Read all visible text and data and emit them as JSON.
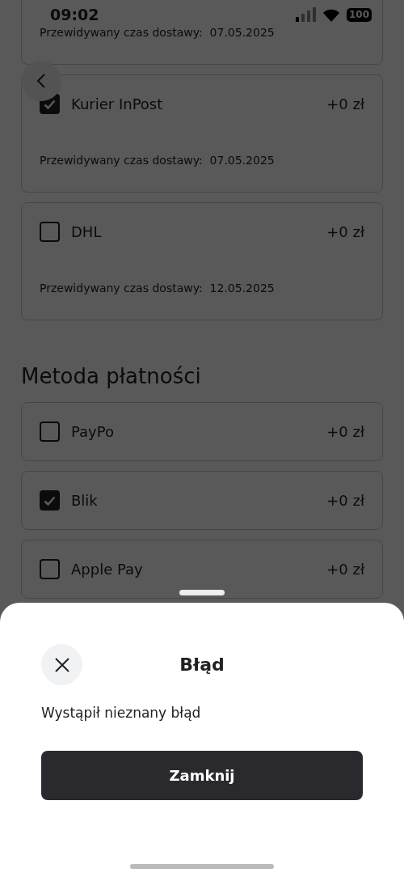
{
  "status_bar": {
    "time": "09:02",
    "battery": "100"
  },
  "partial_delivery_option": {
    "eta_label": "Przewidywany czas dostawy:",
    "eta": "07.05.2025"
  },
  "delivery_options": [
    {
      "name": "Kurier InPost",
      "price": "+0 zł",
      "checked": true,
      "eta_label": "Przewidywany czas dostawy:",
      "eta": "07.05.2025"
    },
    {
      "name": "DHL",
      "price": "+0 zł",
      "checked": false,
      "eta_label": "Przewidywany czas dostawy:",
      "eta": "12.05.2025"
    }
  ],
  "payment_section": {
    "title": "Metoda płatności"
  },
  "payment_methods": [
    {
      "name": "PayPo",
      "price": "+0 zł",
      "checked": false
    },
    {
      "name": "Blik",
      "price": "+0 zł",
      "checked": true
    },
    {
      "name": "Apple Pay",
      "price": "+0 zł",
      "checked": false
    }
  ],
  "dialog": {
    "title": "Błąd",
    "message": "Wystąpił nieznany błąd",
    "button": "Zamknij"
  }
}
